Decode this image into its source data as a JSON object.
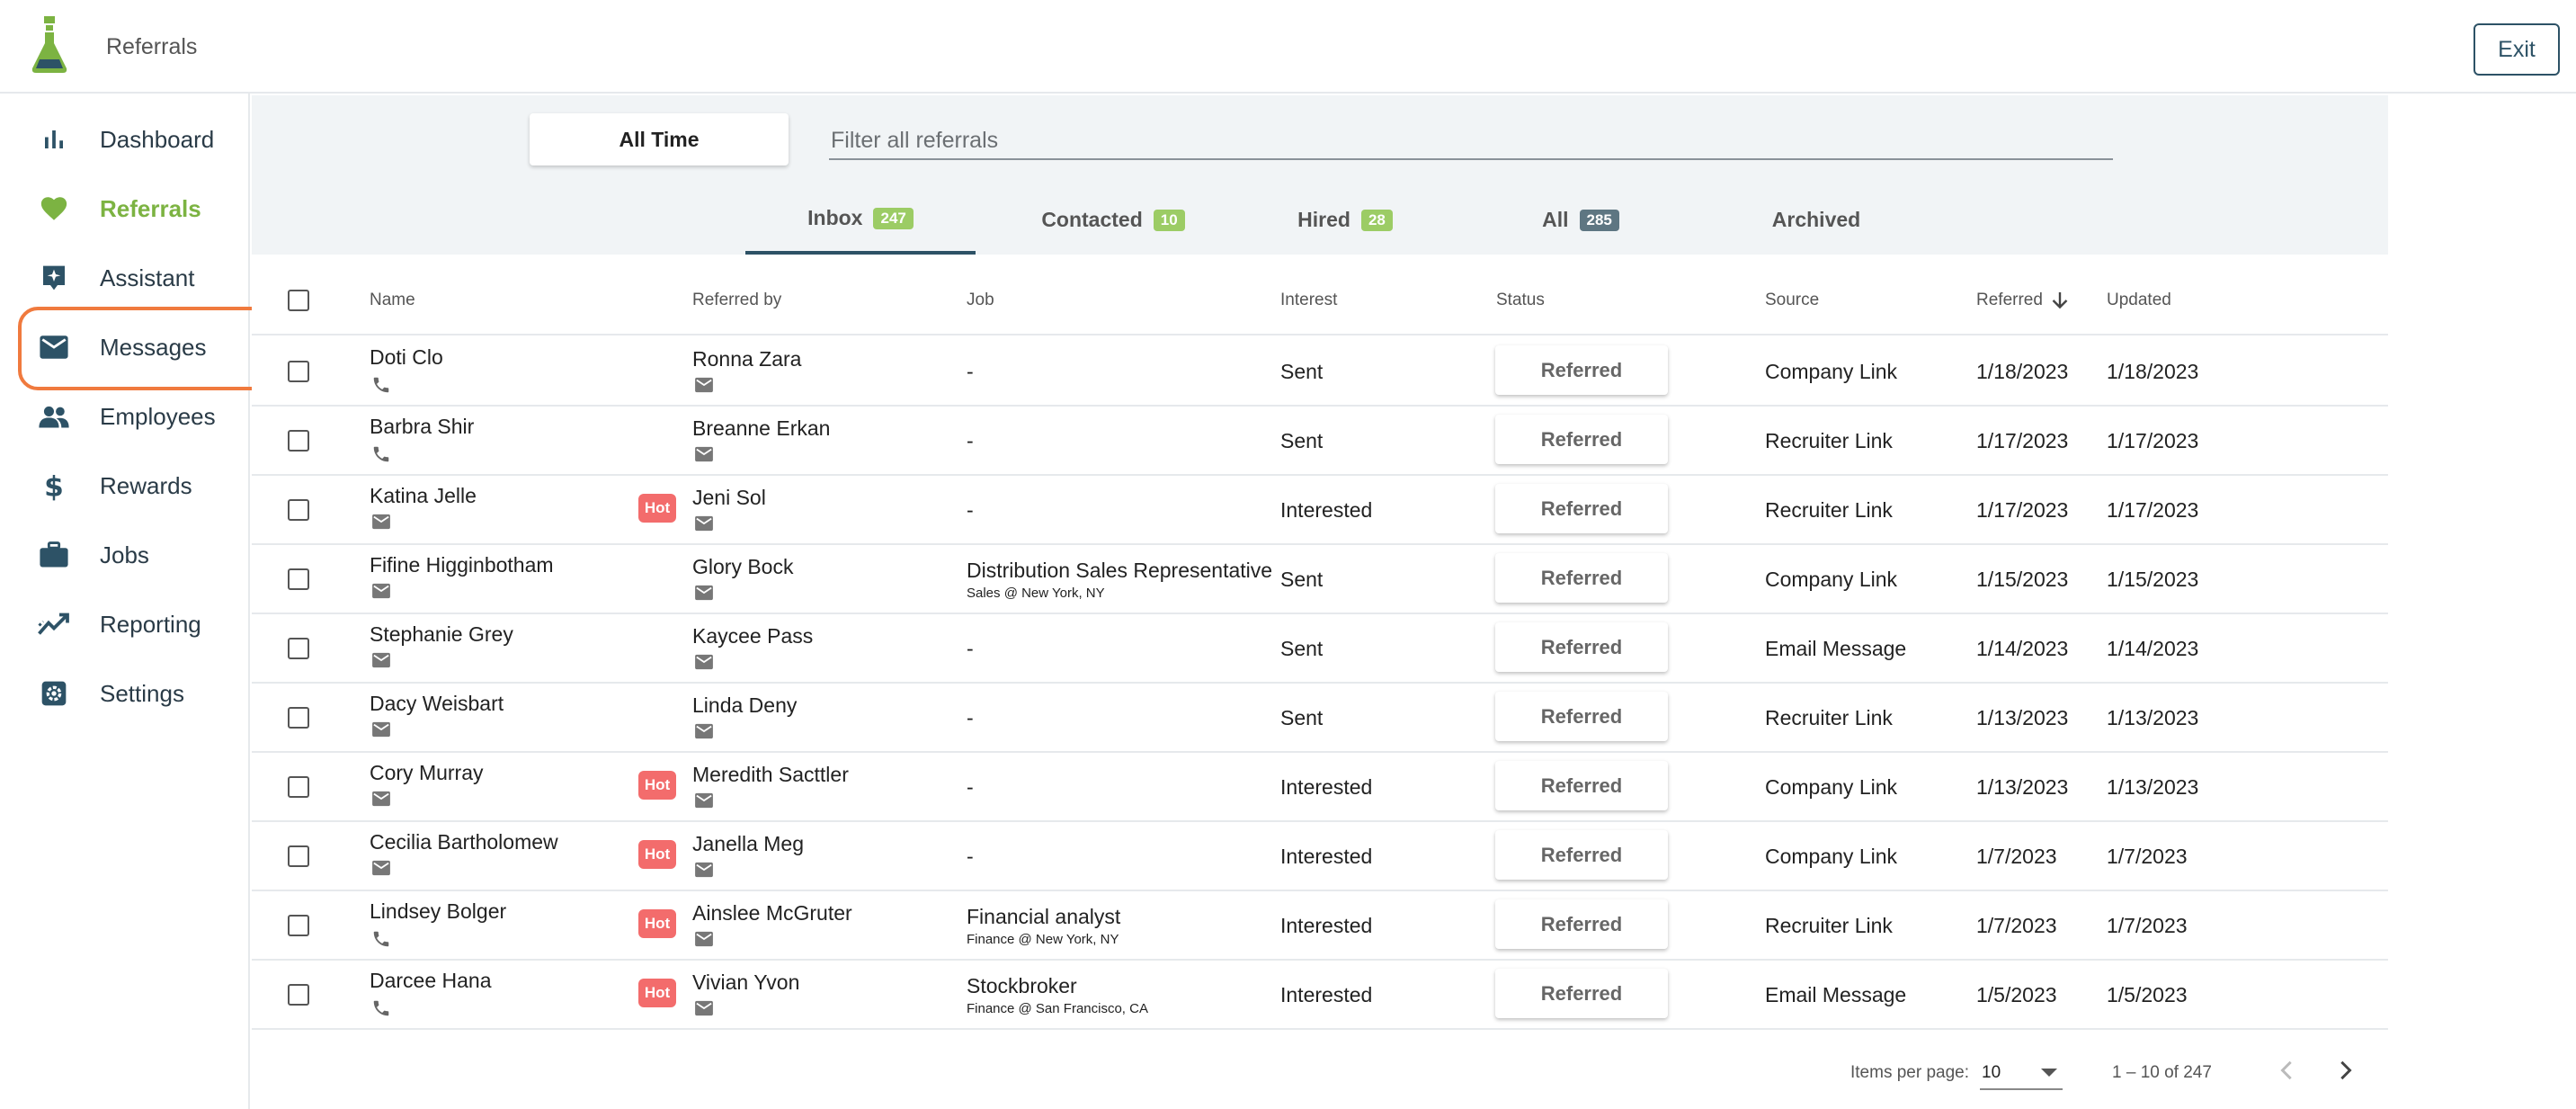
{
  "header": {
    "title": "Referrals",
    "exit_label": "Exit"
  },
  "sidebar": {
    "items": [
      {
        "label": "Dashboard",
        "icon": "bar-chart-icon"
      },
      {
        "label": "Referrals",
        "icon": "heart-icon",
        "active": true
      },
      {
        "label": "Assistant",
        "icon": "sparkle-icon"
      },
      {
        "label": "Messages",
        "icon": "mail-icon",
        "highlighted": true
      },
      {
        "label": "Employees",
        "icon": "people-icon"
      },
      {
        "label": "Rewards",
        "icon": "dollar-icon"
      },
      {
        "label": "Jobs",
        "icon": "briefcase-icon"
      },
      {
        "label": "Reporting",
        "icon": "trend-icon"
      },
      {
        "label": "Settings",
        "icon": "gear-icon"
      }
    ]
  },
  "filters": {
    "time_label": "All Time",
    "search_placeholder": "Filter all referrals"
  },
  "tabs": [
    {
      "label": "Inbox",
      "count": "247",
      "active": true
    },
    {
      "label": "Contacted",
      "count": "10"
    },
    {
      "label": "Hired",
      "count": "28"
    },
    {
      "label": "All",
      "count": "285"
    },
    {
      "label": "Archived",
      "count": ""
    }
  ],
  "table": {
    "columns": [
      "Name",
      "Referred by",
      "Job",
      "Interest",
      "Status",
      "Source",
      "Referred",
      "Updated"
    ],
    "hot_label": "Hot",
    "rows": [
      {
        "name": "Doti Clo",
        "contact": "phone",
        "hot": false,
        "referred_by": "Ronna Zara",
        "job": "-",
        "job_sub": "",
        "interest": "Sent",
        "status": "Referred",
        "source": "Company Link",
        "referred": "1/18/2023",
        "updated": "1/18/2023"
      },
      {
        "name": "Barbra Shir",
        "contact": "phone",
        "hot": false,
        "referred_by": "Breanne Erkan",
        "job": "-",
        "job_sub": "",
        "interest": "Sent",
        "status": "Referred",
        "source": "Recruiter Link",
        "referred": "1/17/2023",
        "updated": "1/17/2023"
      },
      {
        "name": "Katina Jelle",
        "contact": "mail",
        "hot": true,
        "referred_by": "Jeni Sol",
        "job": "-",
        "job_sub": "",
        "interest": "Interested",
        "status": "Referred",
        "source": "Recruiter Link",
        "referred": "1/17/2023",
        "updated": "1/17/2023"
      },
      {
        "name": "Fifine Higginbotham",
        "contact": "mail",
        "hot": false,
        "referred_by": "Glory Bock",
        "job": "Distribution Sales Representative",
        "job_sub": "Sales  @  New York, NY",
        "interest": "Sent",
        "status": "Referred",
        "source": "Company Link",
        "referred": "1/15/2023",
        "updated": "1/15/2023"
      },
      {
        "name": "Stephanie Grey",
        "contact": "mail",
        "hot": false,
        "referred_by": "Kaycee Pass",
        "job": "-",
        "job_sub": "",
        "interest": "Sent",
        "status": "Referred",
        "source": "Email Message",
        "referred": "1/14/2023",
        "updated": "1/14/2023"
      },
      {
        "name": "Dacy Weisbart",
        "contact": "mail",
        "hot": false,
        "referred_by": "Linda Deny",
        "job": "-",
        "job_sub": "",
        "interest": "Sent",
        "status": "Referred",
        "source": "Recruiter Link",
        "referred": "1/13/2023",
        "updated": "1/13/2023"
      },
      {
        "name": "Cory Murray",
        "contact": "mail",
        "hot": true,
        "referred_by": "Meredith Sacttler",
        "job": "-",
        "job_sub": "",
        "interest": "Interested",
        "status": "Referred",
        "source": "Company Link",
        "referred": "1/13/2023",
        "updated": "1/13/2023"
      },
      {
        "name": "Cecilia Bartholomew",
        "contact": "mail",
        "hot": true,
        "referred_by": "Janella Meg",
        "job": "-",
        "job_sub": "",
        "interest": "Interested",
        "status": "Referred",
        "source": "Company Link",
        "referred": "1/7/2023",
        "updated": "1/7/2023"
      },
      {
        "name": "Lindsey Bolger",
        "contact": "phone",
        "hot": true,
        "referred_by": "Ainslee McGruter",
        "job": "Financial analyst",
        "job_sub": "Finance  @  New York, NY",
        "interest": "Interested",
        "status": "Referred",
        "source": "Recruiter Link",
        "referred": "1/7/2023",
        "updated": "1/7/2023"
      },
      {
        "name": "Darcee Hana",
        "contact": "phone",
        "hot": true,
        "referred_by": "Vivian Yvon",
        "job": "Stockbroker",
        "job_sub": "Finance  @  San Francisco, CA",
        "interest": "Interested",
        "status": "Referred",
        "source": "Email Message",
        "referred": "1/5/2023",
        "updated": "1/5/2023"
      }
    ]
  },
  "pagination": {
    "items_per_page_label": "Items per page:",
    "items_per_page": "10",
    "range": "1 – 10 of 247"
  },
  "colors": {
    "accent_green": "#7cb342",
    "badge_green": "#9ccc65",
    "badge_grey": "#5e7682",
    "hot_red": "#f36c6c",
    "highlight_orange": "#f07a3e",
    "navy": "#2d5266"
  }
}
